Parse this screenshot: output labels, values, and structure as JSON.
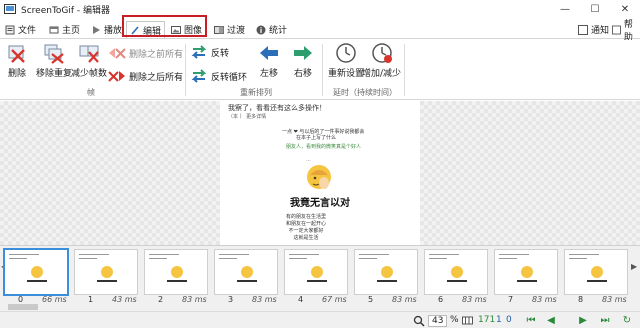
{
  "window": {
    "title": "ScreenToGif - 编辑器",
    "minimize": "—",
    "maximize": "☐",
    "close": "✕"
  },
  "tabs": [
    {
      "label": "文件",
      "icon": "file-icon"
    },
    {
      "label": "主页",
      "icon": "home-icon"
    },
    {
      "label": "播放",
      "icon": "play-icon"
    },
    {
      "label": "编辑",
      "icon": "pencil-icon"
    },
    {
      "label": "图像",
      "icon": "image-icon"
    },
    {
      "label": "过渡",
      "icon": "transition-icon"
    },
    {
      "label": "统计",
      "icon": "info-icon"
    }
  ],
  "top_right": {
    "notify": "通知",
    "help": "帮助"
  },
  "ribbon": {
    "delete": "删除",
    "remove_duplicates": "移除重复",
    "reduce_frames": "减少帧数",
    "delete_previous": "删除之前所有",
    "delete_next": "删除之后所有",
    "reverse": "反转",
    "yoyo": "反转循环",
    "move_left": "左移",
    "move_right": "右移",
    "override_delay": "重新设置",
    "increase_delay": "增加/减少",
    "group_frames": "帧",
    "group_reorder": "重新排列",
    "group_delay": "延时（持续时间）"
  },
  "canvas_frame": {
    "line1": "我察了，看看还有这么多操作！",
    "line2": "（本      ）          更多详情",
    "line3": "一点 ❤ 与以后的了一件事好说我都会",
    "line4": "在本子上写了什么",
    "line5": "朋友人，看到我的微笑真是个好人",
    "line6": "...",
    "big_text": "我竟无言以对",
    "line7": "有的朋友在生活里\n和朋友在一起开心\n不一定大家都好\n这就是生活"
  },
  "filmstrip": [
    {
      "index": "0",
      "ms": "66 ms"
    },
    {
      "index": "1",
      "ms": "43 ms"
    },
    {
      "index": "2",
      "ms": "83 ms"
    },
    {
      "index": "3",
      "ms": "83 ms"
    },
    {
      "index": "4",
      "ms": "67 ms"
    },
    {
      "index": "5",
      "ms": "83 ms"
    },
    {
      "index": "6",
      "ms": "83 ms"
    },
    {
      "index": "7",
      "ms": "83 ms"
    },
    {
      "index": "8",
      "ms": "83 ms"
    }
  ],
  "status": {
    "zoom": "43",
    "percent": "%",
    "frame_count": "171",
    "selected": "1",
    "current": "0"
  },
  "colors": {
    "highlight": "#c81d25",
    "accent": "#3a8edb",
    "status_green": "#2a8a3a",
    "status_blue": "#1f5fa8"
  }
}
